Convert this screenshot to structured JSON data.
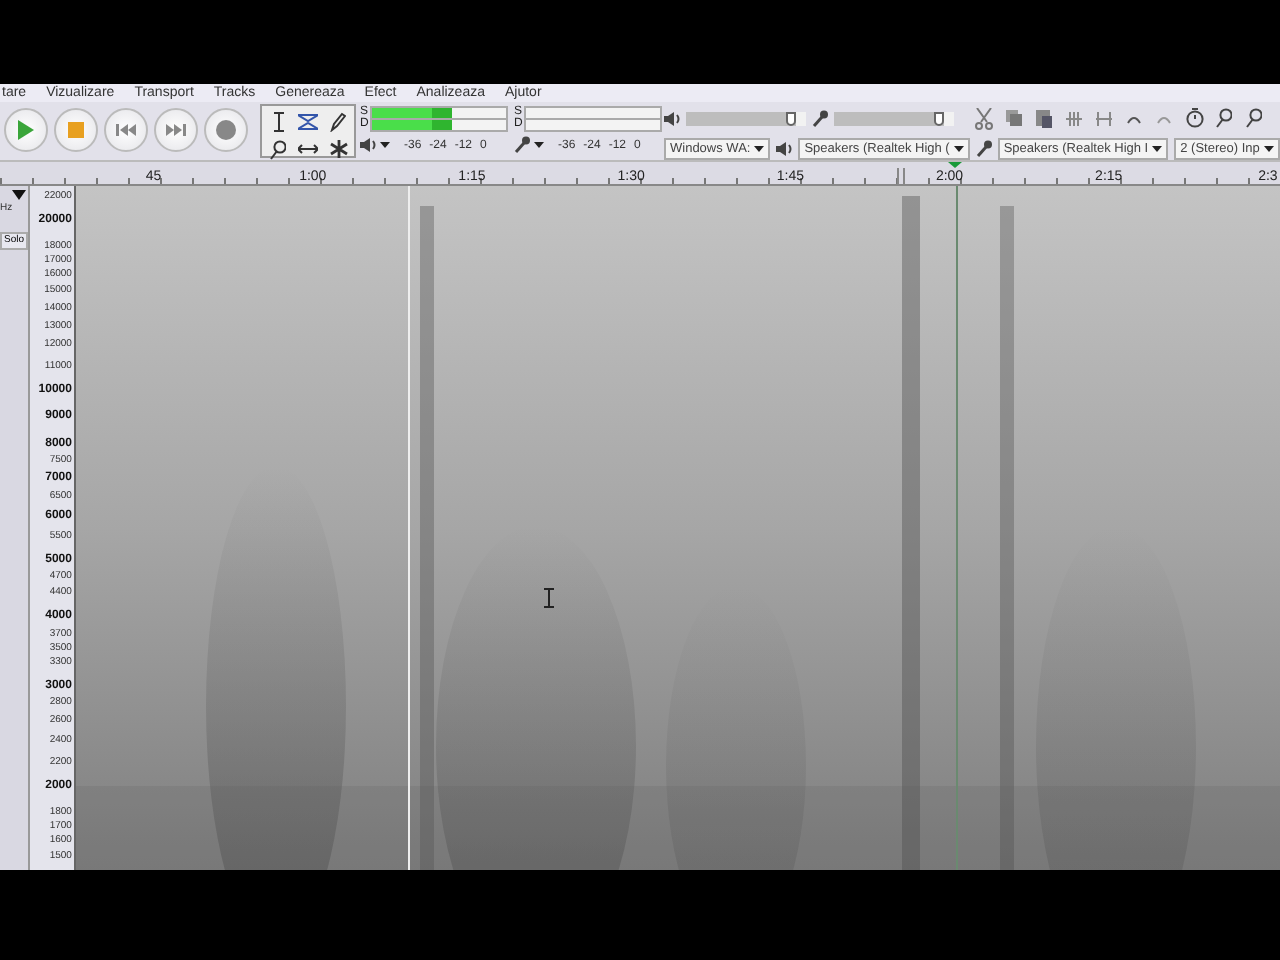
{
  "menu": [
    "tare",
    "Vizualizare",
    "Transport",
    "Tracks",
    "Genereaza",
    "Efect",
    "Analizeaza",
    "Ajutor"
  ],
  "playback_meter": {
    "channels": [
      {
        "label": "S",
        "level": 0.6
      },
      {
        "label": "D",
        "level": 0.6
      }
    ],
    "scale": [
      "-36",
      "-24",
      "-12",
      "0"
    ]
  },
  "record_meter": {
    "channels": [
      {
        "label": "S",
        "level": 0
      },
      {
        "label": "D",
        "level": 0
      }
    ],
    "scale": [
      "-36",
      "-24",
      "-12",
      "0"
    ]
  },
  "mixer": {
    "output": {
      "level": 0.92
    },
    "input": {
      "level": 0.92
    }
  },
  "devices": {
    "host": "Windows WA:",
    "playback": "Speakers (Realtek High (",
    "recording": "Speakers (Realtek High I",
    "channels": "2 (Stereo) Inp"
  },
  "ruler": [
    "45",
    "1:00",
    "1:15",
    "1:30",
    "1:45",
    "2:00",
    "2:15",
    "2:3"
  ],
  "track": {
    "rate": "Hz",
    "solo": "Solo",
    "freq_labels": [
      {
        "text": "22000",
        "major": false
      },
      {
        "text": "20000",
        "major": true
      },
      {
        "text": "18000",
        "major": false
      },
      {
        "text": "17000",
        "major": false
      },
      {
        "text": "16000",
        "major": false
      },
      {
        "text": "15000",
        "major": false
      },
      {
        "text": "14000",
        "major": false
      },
      {
        "text": "13000",
        "major": false
      },
      {
        "text": "12000",
        "major": false
      },
      {
        "text": "11000",
        "major": false
      },
      {
        "text": "10000",
        "major": true
      },
      {
        "text": "9000",
        "major": true
      },
      {
        "text": "8000",
        "major": true
      },
      {
        "text": "7500",
        "major": false
      },
      {
        "text": "7000",
        "major": true
      },
      {
        "text": "6500",
        "major": false
      },
      {
        "text": "6000",
        "major": true
      },
      {
        "text": "5500",
        "major": false
      },
      {
        "text": "5000",
        "major": true
      },
      {
        "text": "4700",
        "major": false
      },
      {
        "text": "4400",
        "major": false
      },
      {
        "text": "4000",
        "major": true
      },
      {
        "text": "3700",
        "major": false
      },
      {
        "text": "3500",
        "major": false
      },
      {
        "text": "3300",
        "major": false
      },
      {
        "text": "3000",
        "major": true
      },
      {
        "text": "2800",
        "major": false
      },
      {
        "text": "2600",
        "major": false
      },
      {
        "text": "2400",
        "major": false
      },
      {
        "text": "2200",
        "major": false
      },
      {
        "text": "2000",
        "major": true
      },
      {
        "text": "1800",
        "major": false
      },
      {
        "text": "1700",
        "major": false
      },
      {
        "text": "1600",
        "major": false
      },
      {
        "text": "1500",
        "major": false
      }
    ]
  }
}
